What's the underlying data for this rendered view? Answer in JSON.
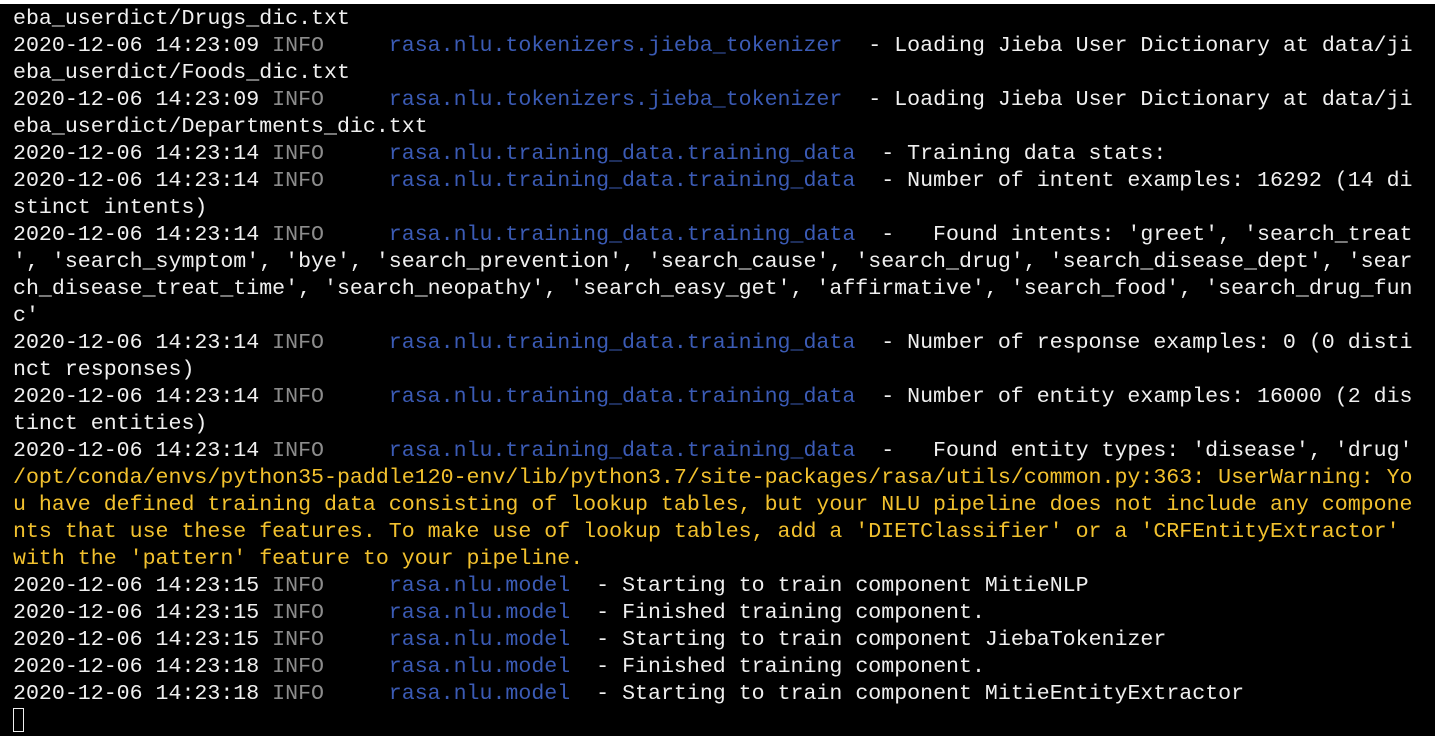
{
  "colors": {
    "background": "#000000",
    "text": "#f0f0f0",
    "level": "#8c8c8c",
    "module": "#3b5bb5",
    "warning": "#f2c12e"
  },
  "lines": [
    {
      "kind": "plain",
      "text": "eba_userdict/Drugs_dic.txt"
    },
    {
      "kind": "log",
      "ts": "2020-12-06 14:23:09 ",
      "level": "INFO    ",
      "module": " rasa.nlu.tokenizers.jieba_tokenizer ",
      "msg": " - Loading Jieba User Dictionary at data/ji"
    },
    {
      "kind": "plain",
      "text": "eba_userdict/Foods_dic.txt"
    },
    {
      "kind": "log",
      "ts": "2020-12-06 14:23:09 ",
      "level": "INFO    ",
      "module": " rasa.nlu.tokenizers.jieba_tokenizer ",
      "msg": " - Loading Jieba User Dictionary at data/ji"
    },
    {
      "kind": "plain",
      "text": "eba_userdict/Departments_dic.txt"
    },
    {
      "kind": "log",
      "ts": "2020-12-06 14:23:14 ",
      "level": "INFO    ",
      "module": " rasa.nlu.training_data.training_data ",
      "msg": " - Training data stats:"
    },
    {
      "kind": "log",
      "ts": "2020-12-06 14:23:14 ",
      "level": "INFO    ",
      "module": " rasa.nlu.training_data.training_data ",
      "msg": " - Number of intent examples: 16292 (14 di"
    },
    {
      "kind": "plain",
      "text": "stinct intents)"
    },
    {
      "kind": "log",
      "ts": "2020-12-06 14:23:14 ",
      "level": "INFO    ",
      "module": " rasa.nlu.training_data.training_data ",
      "msg": " -   Found intents: 'greet', 'search_treat"
    },
    {
      "kind": "plain",
      "text": "', 'search_symptom', 'bye', 'search_prevention', 'search_cause', 'search_drug', 'search_disease_dept', 'sear"
    },
    {
      "kind": "plain",
      "text": "ch_disease_treat_time', 'search_neopathy', 'search_easy_get', 'affirmative', 'search_food', 'search_drug_fun"
    },
    {
      "kind": "plain",
      "text": "c'"
    },
    {
      "kind": "log",
      "ts": "2020-12-06 14:23:14 ",
      "level": "INFO    ",
      "module": " rasa.nlu.training_data.training_data ",
      "msg": " - Number of response examples: 0 (0 disti"
    },
    {
      "kind": "plain",
      "text": "nct responses)"
    },
    {
      "kind": "log",
      "ts": "2020-12-06 14:23:14 ",
      "level": "INFO    ",
      "module": " rasa.nlu.training_data.training_data ",
      "msg": " - Number of entity examples: 16000 (2 dis"
    },
    {
      "kind": "plain",
      "text": "tinct entities)"
    },
    {
      "kind": "log",
      "ts": "2020-12-06 14:23:14 ",
      "level": "INFO    ",
      "module": " rasa.nlu.training_data.training_data ",
      "msg": " -   Found entity types: 'disease', 'drug'"
    },
    {
      "kind": "warn",
      "text": "/opt/conda/envs/python35-paddle120-env/lib/python3.7/site-packages/rasa/utils/common.py:363: UserWarning: Yo"
    },
    {
      "kind": "warn",
      "text": "u have defined training data consisting of lookup tables, but your NLU pipeline does not include any compone"
    },
    {
      "kind": "warn",
      "text": "nts that use these features. To make use of lookup tables, add a 'DIETClassifier' or a 'CRFEntityExtractor'"
    },
    {
      "kind": "warn",
      "text": "with the 'pattern' feature to your pipeline."
    },
    {
      "kind": "log",
      "ts": "2020-12-06 14:23:15 ",
      "level": "INFO    ",
      "module": " rasa.nlu.model ",
      "msg": " - Starting to train component MitieNLP"
    },
    {
      "kind": "log",
      "ts": "2020-12-06 14:23:15 ",
      "level": "INFO    ",
      "module": " rasa.nlu.model ",
      "msg": " - Finished training component."
    },
    {
      "kind": "log",
      "ts": "2020-12-06 14:23:15 ",
      "level": "INFO    ",
      "module": " rasa.nlu.model ",
      "msg": " - Starting to train component JiebaTokenizer"
    },
    {
      "kind": "log",
      "ts": "2020-12-06 14:23:18 ",
      "level": "INFO    ",
      "module": " rasa.nlu.model ",
      "msg": " - Finished training component."
    },
    {
      "kind": "log",
      "ts": "2020-12-06 14:23:18 ",
      "level": "INFO    ",
      "module": " rasa.nlu.model ",
      "msg": " - Starting to train component MitieEntityExtractor"
    }
  ]
}
